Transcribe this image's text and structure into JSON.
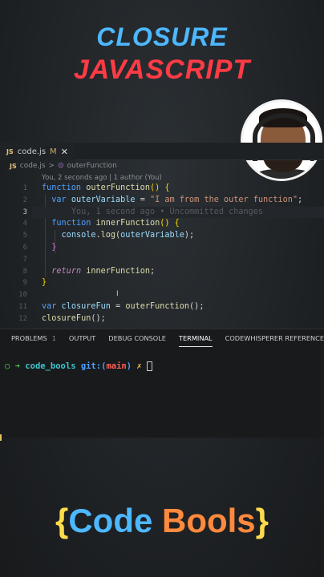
{
  "header": {
    "line1": "CLOSURE",
    "line2": "JAVASCRIPT"
  },
  "editor": {
    "tab": {
      "badge": "JS",
      "name": "code.js",
      "state": "M",
      "close": "✕"
    },
    "breadcrumb": {
      "badge": "JS",
      "file": "code.js",
      "sep": ">",
      "symbol": "outerFunction"
    },
    "blame": "You, 2 seconds ago | 1 author (You)",
    "inline_blame": "You, 1 second ago • Uncommitted changes",
    "line_numbers": [
      "1",
      "2",
      "3",
      "4",
      "5",
      "6",
      "7",
      "8",
      "9",
      "10",
      "11",
      "12"
    ]
  },
  "panel": {
    "tabs": [
      {
        "label": "PROBLEMS",
        "count": "1"
      },
      {
        "label": "OUTPUT"
      },
      {
        "label": "DEBUG CONSOLE"
      },
      {
        "label": "TERMINAL"
      },
      {
        "label": "CODEWHISPERER REFERENCE LO"
      }
    ],
    "active_tab": "TERMINAL",
    "terminal": {
      "prompt": "○ ➜",
      "dir": "code_bools",
      "git": "git:(",
      "branch": "main",
      "git_close": ")",
      "dirty": "✗"
    }
  },
  "brand": {
    "open": "{",
    "word1": "Code",
    "word2": "Bools",
    "close": "}"
  },
  "colors": {
    "accent_blue": "#4db8ff",
    "accent_red": "#ff3b45",
    "brand_orange": "#ff8a3d",
    "brand_yellow": "#fddc4b"
  }
}
